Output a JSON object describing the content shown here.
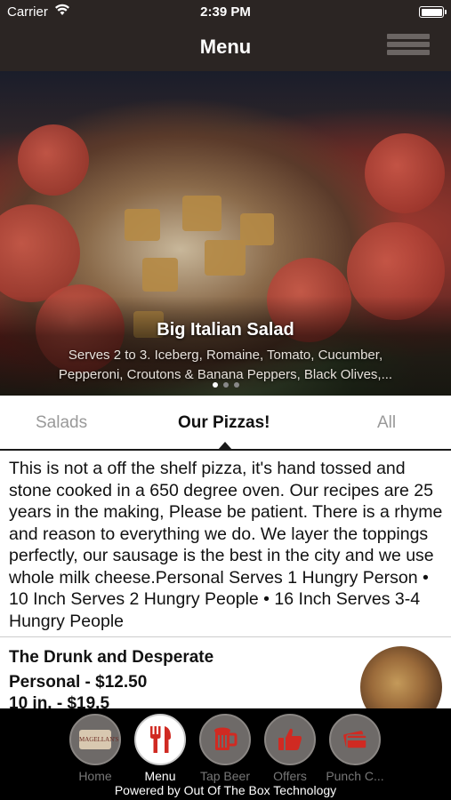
{
  "status_bar": {
    "carrier": "Carrier",
    "time": "2:39 PM",
    "icons": [
      "wifi-icon",
      "battery-icon"
    ]
  },
  "nav": {
    "title": "Menu",
    "menu_icon": "hamburger-menu-icon"
  },
  "hero": {
    "title": "Big Italian Salad",
    "description_line1": "Serves 2 to 3. Iceberg, Romaine, Tomato, Cucumber,",
    "description_line2": "Pepperoni, Croutons & Banana Peppers, Black Olives,...",
    "page_count": 3,
    "active_page": 0
  },
  "tabs": [
    {
      "label": "Salads",
      "active": false
    },
    {
      "label": "Our Pizzas!",
      "active": true
    },
    {
      "label": "All",
      "active": false
    }
  ],
  "description": {
    "text": "This is not a off the shelf pizza, it's hand tossed and stone cooked in a  650 degree oven. Our recipes are 25 years in the making, Please be patient.  There is a rhyme and reason to everything we do.  We layer the toppings perfectly, our sausage is the best in the city and we use whole milk cheese.Personal Serves 1 Hungry Person • 10 Inch Serves 2 Hungry People • 16 Inch Serves 3-4 Hungry People"
  },
  "menu_item": {
    "name": "The Drunk and Desperate",
    "price_line1": "Personal - $12.50",
    "price_line2": "10 in. - $19.5"
  },
  "tab_bar": {
    "items": [
      {
        "label": "Home",
        "icon": "restaurant-logo-icon",
        "active": false
      },
      {
        "label": "Menu",
        "icon": "fork-knife-icon",
        "active": true
      },
      {
        "label": "Tap Beer",
        "icon": "beer-mug-icon",
        "active": false
      },
      {
        "label": "Offers",
        "icon": "thumbs-up-icon",
        "active": false
      },
      {
        "label": "Punch C...",
        "icon": "punch-card-icon",
        "active": false
      }
    ],
    "powered_by": "Powered by Out Of The Box Technology",
    "logo_text": "MAGELLAN'S"
  },
  "colors": {
    "nav_bg": "#2b2523",
    "accent_red": "#d02a22",
    "tab_inactive": "#999999"
  }
}
